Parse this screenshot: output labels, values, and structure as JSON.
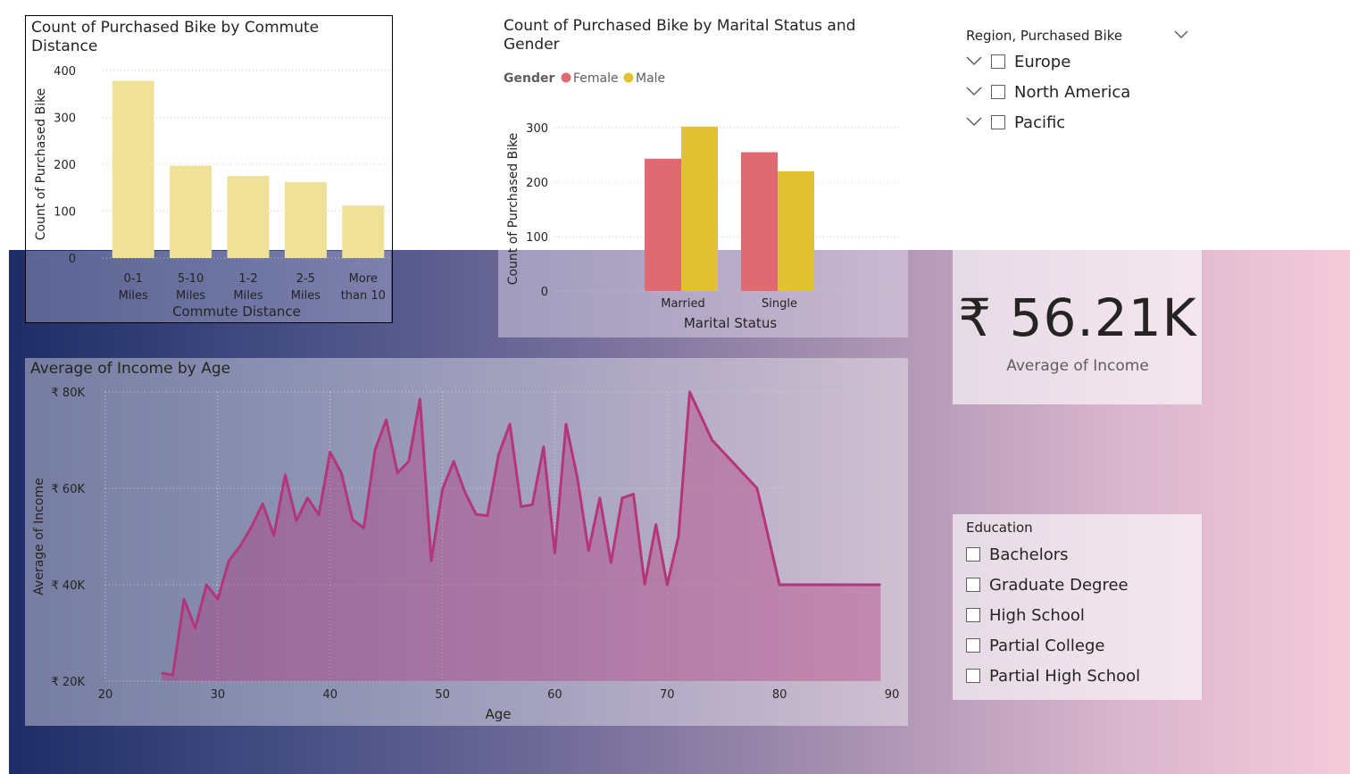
{
  "chart_data": [
    {
      "type": "bar",
      "title": "Count of Purchased Bike by Commute Distance",
      "xlabel": "Commute Distance",
      "ylabel": "Count of Purchased Bike",
      "categories": [
        [
          "0-1",
          "Miles"
        ],
        [
          "5-10",
          "Miles"
        ],
        [
          "1-2",
          "Miles"
        ],
        [
          "2-5",
          "Miles"
        ],
        [
          "More",
          "than 10"
        ]
      ],
      "values": [
        378,
        197,
        175,
        162,
        112
      ],
      "yticks": [
        "0",
        "100",
        "200",
        "300",
        "400"
      ],
      "ylim": [
        0,
        400
      ],
      "color": "#f0e199"
    },
    {
      "type": "bar",
      "title": "Count of Purchased Bike by Marital Status and Gender",
      "xlabel": "Marital Status",
      "ylabel": "Count of Purchased Bike",
      "legend_title": "Gender",
      "categories": [
        "Married",
        "Single"
      ],
      "series": [
        {
          "name": "Female",
          "values": [
            243,
            255
          ],
          "color": "#e06a72"
        },
        {
          "name": "Male",
          "values": [
            302,
            220
          ],
          "color": "#e1c233"
        }
      ],
      "yticks": [
        "0",
        "100",
        "200",
        "300"
      ],
      "ylim": [
        0,
        300
      ]
    },
    {
      "type": "area",
      "title": "Average of Income by Age",
      "xlabel": "Age",
      "ylabel": "Average of Income",
      "xticks": [
        "20",
        "30",
        "40",
        "50",
        "60",
        "70",
        "80",
        "90"
      ],
      "yticks": [
        "₹ 20K",
        "₹ 40K",
        "₹ 60K",
        "₹ 80K"
      ],
      "xlim": [
        20,
        90
      ],
      "ylim": [
        20000,
        80000
      ],
      "color": "#b5357b",
      "x": [
        25,
        26,
        27,
        28,
        29,
        30,
        31,
        32,
        33,
        34,
        35,
        36,
        37,
        38,
        39,
        40,
        41,
        42,
        43,
        44,
        45,
        46,
        47,
        48,
        49,
        50,
        51,
        52,
        53,
        54,
        55,
        56,
        57,
        58,
        59,
        60,
        61,
        62,
        63,
        64,
        65,
        66,
        67,
        68,
        69,
        70,
        71,
        72,
        74,
        78,
        80,
        89
      ],
      "y": [
        21700,
        21300,
        37000,
        31000,
        40000,
        37000,
        45000,
        48000,
        52000,
        56800,
        50200,
        62800,
        53300,
        58000,
        54500,
        67500,
        63200,
        53500,
        51800,
        68000,
        74200,
        63200,
        65600,
        78500,
        45000,
        59800,
        65600,
        59200,
        54600,
        54300,
        67000,
        73300,
        56200,
        56600,
        68600,
        46600,
        73300,
        62300,
        47100,
        58000,
        44600,
        58000,
        58800,
        40100,
        52500,
        40000,
        50000,
        80000,
        70000,
        60000,
        40000,
        40000
      ]
    }
  ],
  "kpi": {
    "value": "₹ 56.21K",
    "label": "Average of Income"
  },
  "region_slicer": {
    "header": "Region, Purchased Bike",
    "items": [
      "Europe",
      "North America",
      "Pacific"
    ]
  },
  "education_slicer": {
    "header": "Education",
    "items": [
      "Bachelors",
      "Graduate Degree",
      "High School",
      "Partial College",
      "Partial High School"
    ]
  }
}
